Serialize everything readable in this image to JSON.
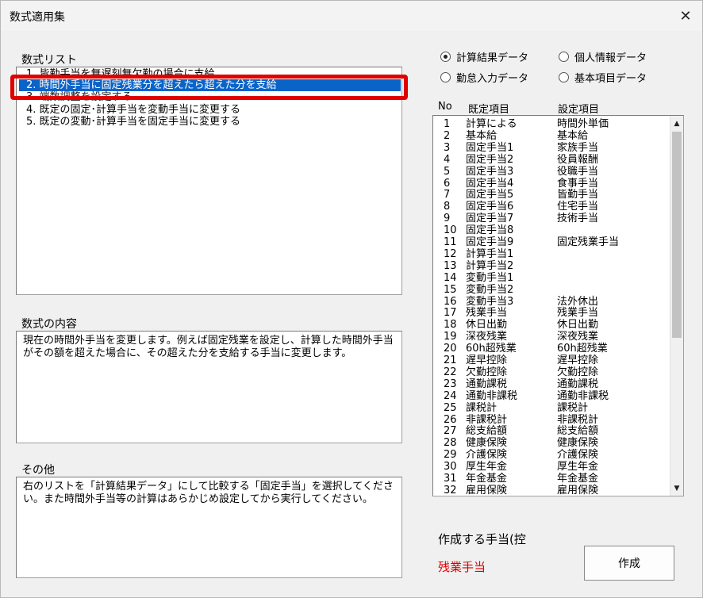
{
  "window": {
    "title": "数式適用集"
  },
  "formula_list": {
    "label": "数式リスト",
    "items": [
      "1. 皆勤手当を無遅刻無欠勤の場合に支給",
      "2. 時間外手当に固定残業分を超えたら超えた分を支給",
      "3. 端数調整を設定する",
      "4. 既定の固定･計算手当を変動手当に変更する",
      "5. 既定の変動･計算手当を固定手当に変更する"
    ],
    "selected_index": 1
  },
  "formula_content": {
    "label": "数式の内容",
    "text": "現在の時間外手当を変更します。例えば固定残業を設定し、計算した時間外手当がその額を超えた場合に、その超えた分を支給する手当に変更します。"
  },
  "other": {
    "label": "その他",
    "text": "右のリストを「計算結果データ」にして比較する「固定手当」を選択してください。また時間外手当等の計算はあらかじめ設定してから実行してください。"
  },
  "radios": [
    {
      "label": "計算結果データ",
      "checked": true
    },
    {
      "label": "個人情報データ",
      "checked": false
    },
    {
      "label": "勤怠入力データ",
      "checked": false
    },
    {
      "label": "基本項目データ",
      "checked": false
    }
  ],
  "table": {
    "headers": {
      "no": "No",
      "default": "既定項目",
      "setting": "設定項目"
    },
    "rows": [
      [
        "1",
        "計算による",
        "時間外単価"
      ],
      [
        "2",
        "基本給",
        "基本給"
      ],
      [
        "3",
        "固定手当1",
        "家族手当"
      ],
      [
        "4",
        "固定手当2",
        "役員報酬"
      ],
      [
        "5",
        "固定手当3",
        "役職手当"
      ],
      [
        "6",
        "固定手当4",
        "食事手当"
      ],
      [
        "7",
        "固定手当5",
        "皆勤手当"
      ],
      [
        "8",
        "固定手当6",
        "住宅手当"
      ],
      [
        "9",
        "固定手当7",
        "技術手当"
      ],
      [
        "10",
        "固定手当8",
        ""
      ],
      [
        "11",
        "固定手当9",
        "固定残業手当"
      ],
      [
        "12",
        "計算手当1",
        ""
      ],
      [
        "13",
        "計算手当2",
        ""
      ],
      [
        "14",
        "変動手当1",
        ""
      ],
      [
        "15",
        "変動手当2",
        ""
      ],
      [
        "16",
        "変動手当3",
        "法外休出"
      ],
      [
        "17",
        "残業手当",
        "残業手当"
      ],
      [
        "18",
        "休日出勤",
        "休日出勤"
      ],
      [
        "19",
        "深夜残業",
        "深夜残業"
      ],
      [
        "20",
        "60h超残業",
        "60h超残業"
      ],
      [
        "21",
        "遅早控除",
        "遅早控除"
      ],
      [
        "22",
        "欠勤控除",
        "欠勤控除"
      ],
      [
        "23",
        "通勤課税",
        "通勤課税"
      ],
      [
        "24",
        "通勤非課税",
        "通勤非課税"
      ],
      [
        "25",
        "課税計",
        "課税計"
      ],
      [
        "26",
        "非課税計",
        "非課税計"
      ],
      [
        "27",
        "総支給額",
        "総支給額"
      ],
      [
        "28",
        "健康保険",
        "健康保険"
      ],
      [
        "29",
        "介護保険",
        "介護保険"
      ],
      [
        "30",
        "厚生年金",
        "厚生年金"
      ],
      [
        "31",
        "年金基金",
        "年金基金"
      ],
      [
        "32",
        "雇用保険",
        "雇用保険"
      ]
    ]
  },
  "create": {
    "label": "作成する手当(控",
    "value": "残業手当",
    "button": "作成"
  },
  "colors": {
    "selection": "#0a64c8",
    "highlight": "#e00000"
  },
  "icons": {
    "close": "close-icon",
    "scroll_up": "scroll-up-icon",
    "scroll_down": "scroll-down-icon"
  }
}
